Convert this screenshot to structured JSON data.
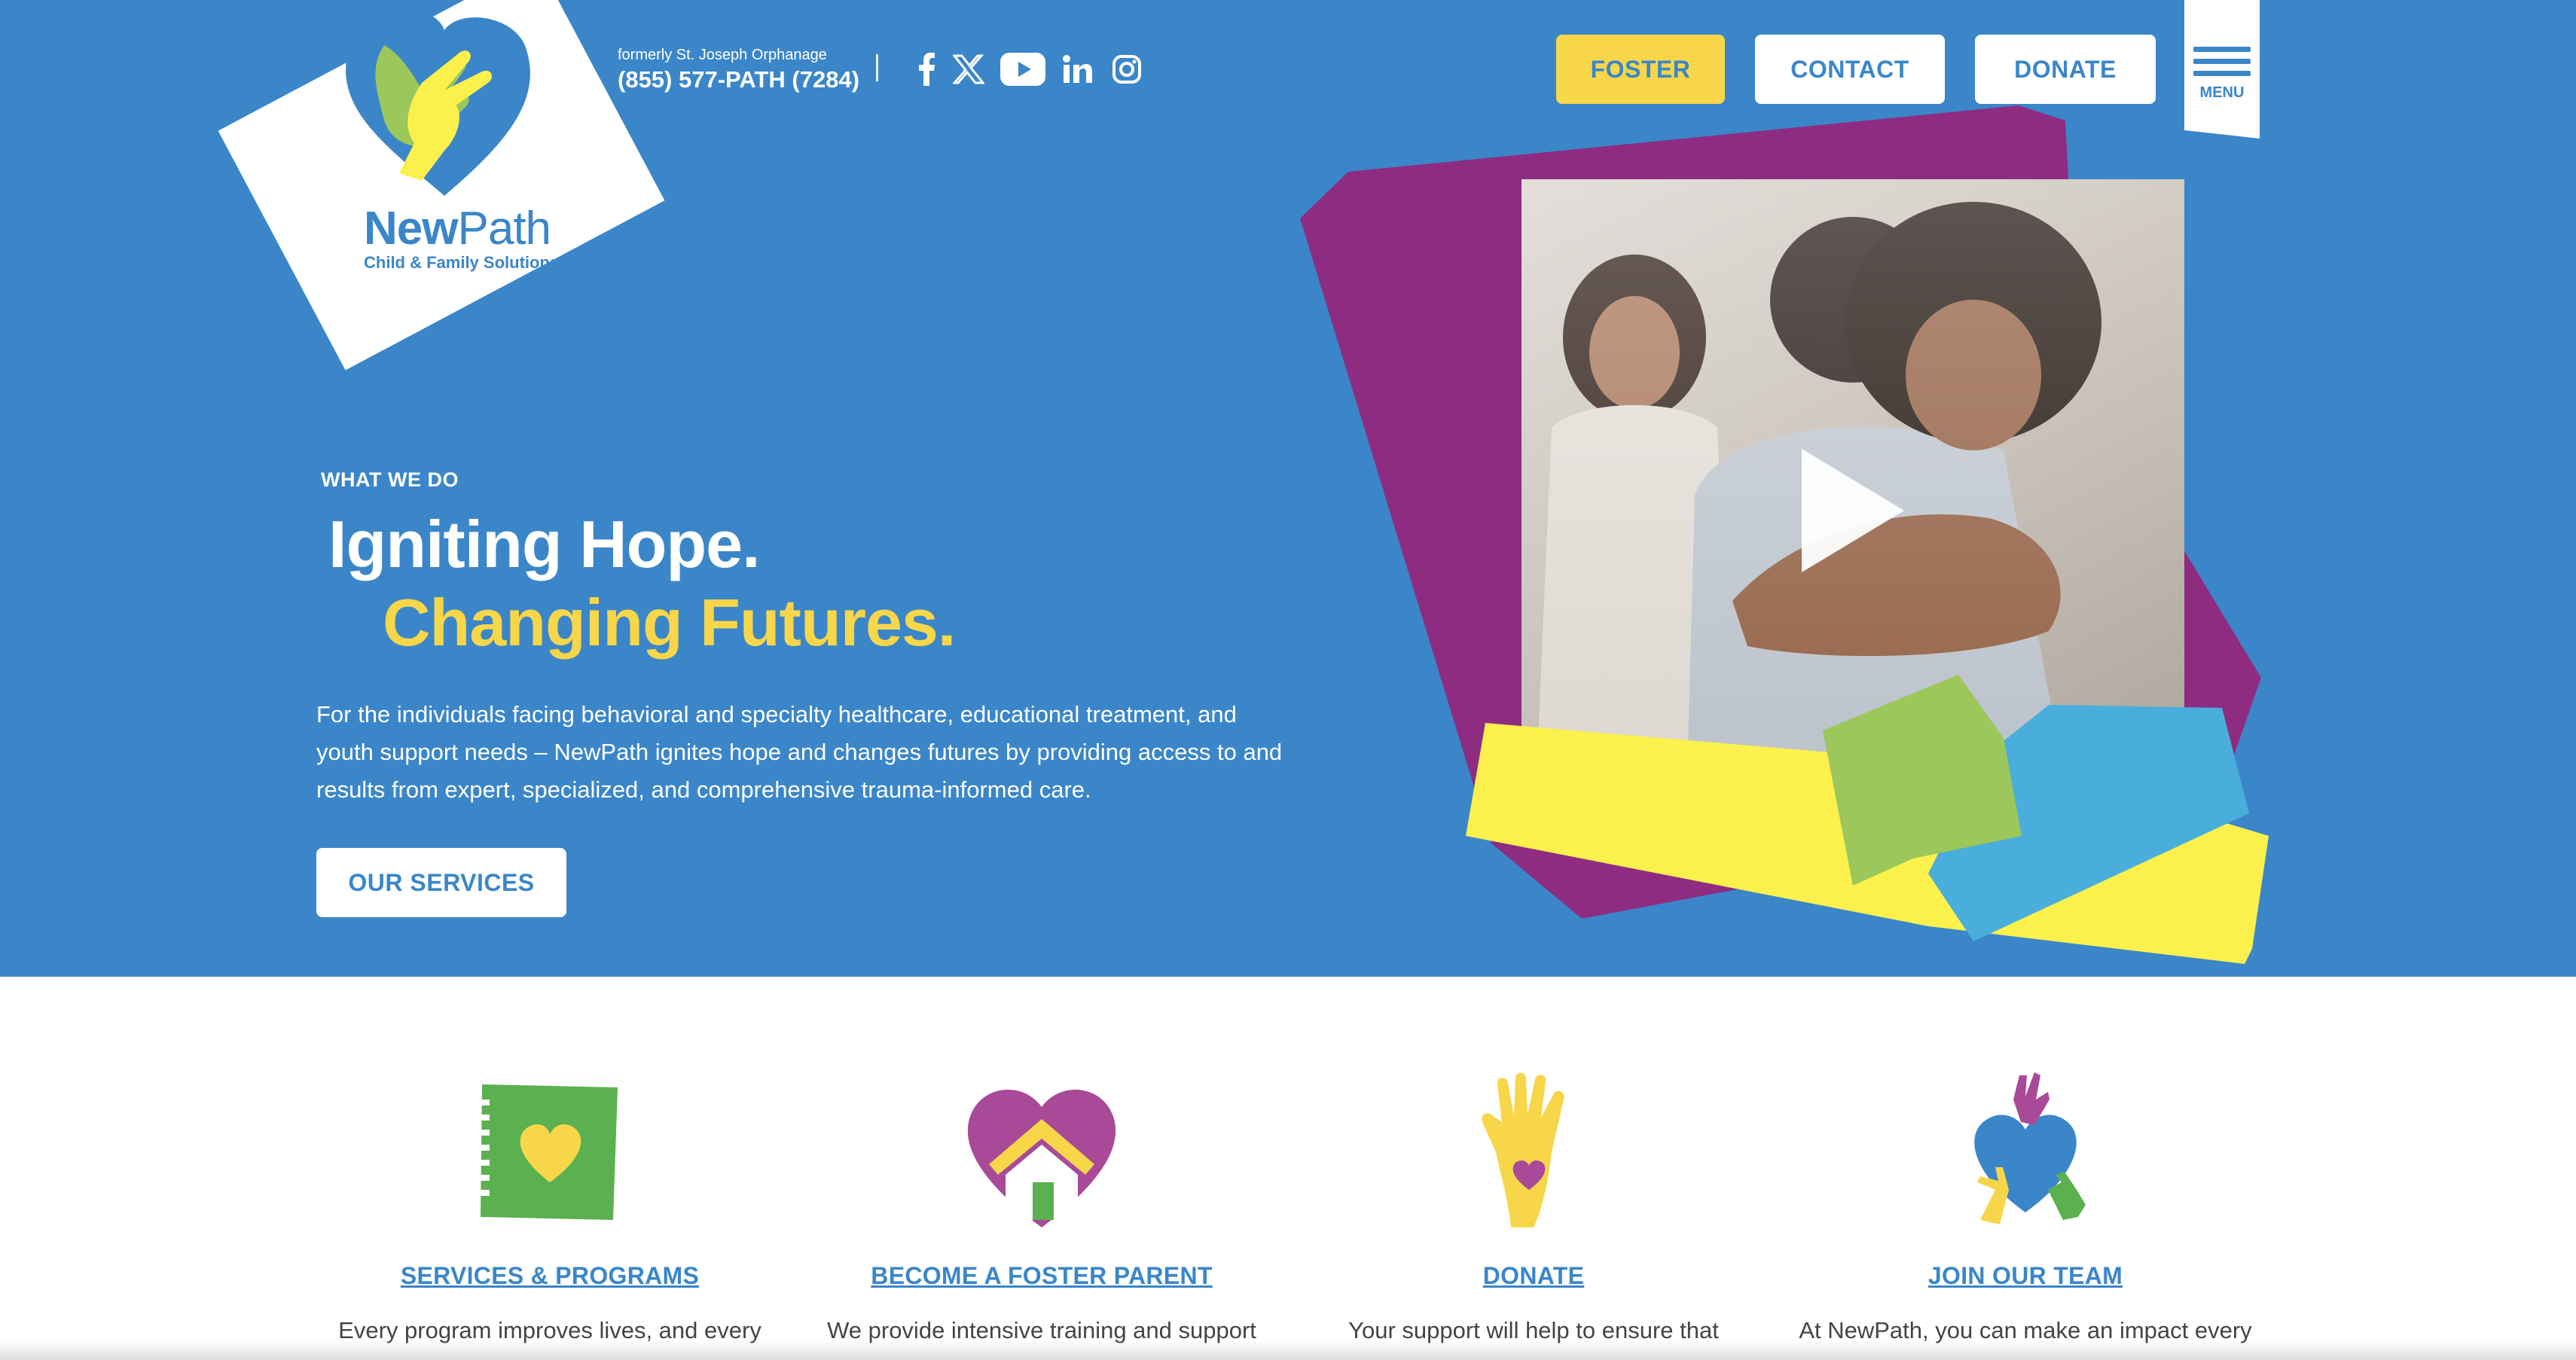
{
  "header": {
    "logo": {
      "word_bold": "New",
      "word_light": "Path",
      "subtitle": "Child & Family Solutions"
    },
    "formerly": "formerly St. Joseph Orphanage",
    "phone": "(855) 577-PATH (7284)",
    "social_icons": [
      "facebook-icon",
      "x-twitter-icon",
      "youtube-icon",
      "linkedin-icon",
      "instagram-icon"
    ],
    "buttons": {
      "foster": "FOSTER",
      "contact": "CONTACT",
      "donate": "DONATE"
    },
    "menu_label": "MENU"
  },
  "hero": {
    "eyebrow": "WHAT WE DO",
    "headline_line1": "Igniting Hope.",
    "headline_line2": "Changing Futures.",
    "lede": "For the individuals facing behavioral and specialty healthcare, educational treatment, and youth support needs – NewPath ignites hope and changes futures by providing access to and results from expert, specialized, and comprehensive trauma-informed care.",
    "cta": "OUR SERVICES",
    "video_icon": "play-icon"
  },
  "cards": [
    {
      "icon": "notebook-heart-icon",
      "title": "SERVICES & PROGRAMS",
      "desc": "Every program improves lives, and every"
    },
    {
      "icon": "heart-house-icon",
      "title": "BECOME A FOSTER PARENT",
      "desc": "We provide intensive training and support"
    },
    {
      "icon": "hand-heart-icon",
      "title": "DONATE",
      "desc": "Your support will help to ensure that"
    },
    {
      "icon": "hands-heart-icon",
      "title": "JOIN OUR TEAM",
      "desc": "At NewPath, you can make an impact every"
    }
  ],
  "colors": {
    "brand_blue": "#3b86c9",
    "accent_yellow": "#f7d649",
    "purple": "#8e2c82",
    "green": "#9cc75a",
    "light_blue": "#4aaedc",
    "bright_yellow": "#fbf04c"
  }
}
